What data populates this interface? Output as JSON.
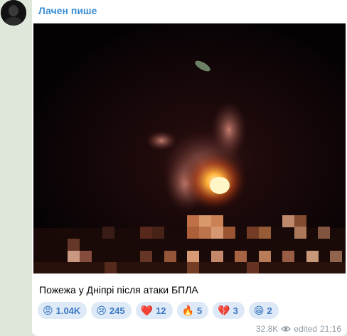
{
  "channel": {
    "name": "Лачен пише",
    "avatar_icon": "person-avatar"
  },
  "post": {
    "media_icon": "photo",
    "caption": "Пожежа у Дніпрі після атаки БПЛА",
    "reactions": [
      {
        "icon": "enraged-face",
        "emoji": "😡",
        "count": "1.04K"
      },
      {
        "icon": "crying-face",
        "emoji": "😢",
        "count": "245"
      },
      {
        "icon": "red-heart",
        "emoji": "❤️",
        "count": "12"
      },
      {
        "icon": "fire",
        "emoji": "🔥",
        "count": "5"
      },
      {
        "icon": "broken-heart",
        "emoji": "💔",
        "count": "3"
      },
      {
        "icon": "grinning-face",
        "emoji": "😁",
        "count": "2"
      }
    ],
    "views": "32.8K",
    "edited_label": "edited",
    "time": "21:16"
  }
}
